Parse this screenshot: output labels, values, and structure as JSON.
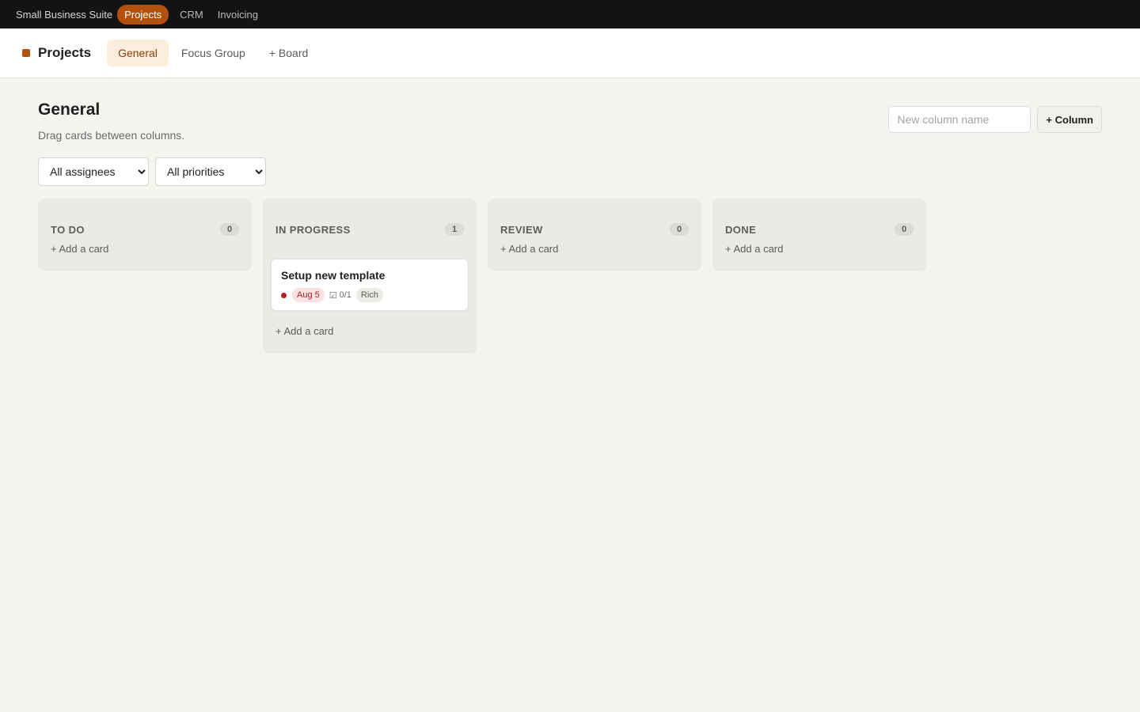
{
  "suite_bar": {
    "brand": "Small Business Suite",
    "items": [
      {
        "label": "Projects",
        "active": true
      },
      {
        "label": "CRM",
        "active": false
      },
      {
        "label": "Invoicing",
        "active": false
      }
    ]
  },
  "app_header": {
    "title": "Projects",
    "accent_color": "#b4500e",
    "tabs": [
      {
        "label": "General",
        "active": true
      },
      {
        "label": "Focus Group",
        "active": false
      },
      {
        "label": "+ Board",
        "active": false
      }
    ]
  },
  "page": {
    "title": "General",
    "subtitle": "Drag cards between columns.",
    "new_column_placeholder": "New column name",
    "add_column_label": "+ Column"
  },
  "filters": {
    "assignee_selected": "All assignees",
    "priority_selected": "All priorities"
  },
  "columns": [
    {
      "title": "TO DO",
      "count": "0",
      "add_label": "+ Add a card",
      "cards": []
    },
    {
      "title": "IN PROGRESS",
      "count": "1",
      "add_label": "+ Add a card",
      "cards": [
        {
          "title": "Setup new template",
          "priority_color": "#b22222",
          "due": "Aug 5",
          "checklist": "0/1",
          "assignee": "Rich"
        }
      ]
    },
    {
      "title": "REVIEW",
      "count": "0",
      "add_label": "+ Add a card",
      "cards": []
    },
    {
      "title": "DONE",
      "count": "0",
      "add_label": "+ Add a card",
      "cards": []
    }
  ]
}
